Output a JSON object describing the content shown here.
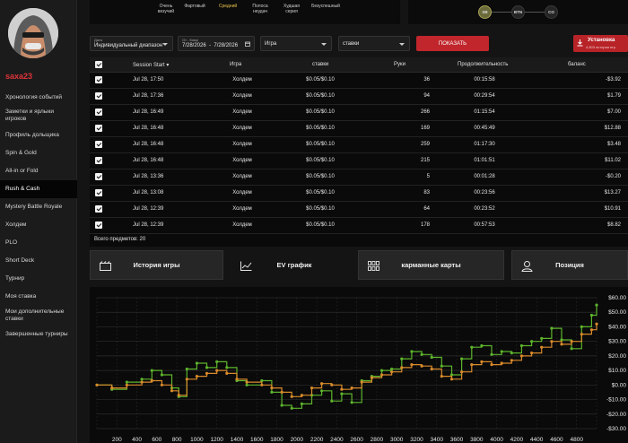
{
  "sidebar": {
    "username": "saxa23",
    "items": [
      {
        "label": "Хронология событий",
        "active": false
      },
      {
        "label": "Заметки и ярлыки игроков",
        "active": false
      },
      {
        "label": "Профиль дольщика",
        "active": false
      },
      {
        "label": "Spin & Gold",
        "active": false
      },
      {
        "label": "All-in or Fold",
        "active": false
      },
      {
        "label": "Rush & Cash",
        "active": true
      },
      {
        "label": "Mystery Battle Royale",
        "active": false
      },
      {
        "label": "Холдем",
        "active": false
      },
      {
        "label": "PLO",
        "active": false
      },
      {
        "label": "Short Deck",
        "active": false
      },
      {
        "label": "Турнир",
        "active": false
      },
      {
        "label": "Моя ставка",
        "active": false
      },
      {
        "label": "Мои дополнительные ставки",
        "active": false
      },
      {
        "label": "Завершенные турниры",
        "active": false
      }
    ]
  },
  "filters": {
    "result_options": [
      {
        "label": "Очень везучий",
        "selected": false
      },
      {
        "label": "Фартовый",
        "selected": false
      },
      {
        "label": "Средний",
        "selected": true
      },
      {
        "label": "Полоса неудач",
        "selected": false
      },
      {
        "label": "Худшая серия",
        "selected": false
      },
      {
        "label": "Безуспешный",
        "selected": false
      }
    ],
    "positions": [
      {
        "label": "SB",
        "selected": true
      },
      {
        "label": "BTN",
        "selected": false
      },
      {
        "label": "CO",
        "selected": false
      }
    ]
  },
  "controls": {
    "date_type_label": "Дата",
    "date_type_value": "Индивидуальный диапазон",
    "range_label": "От - Кому",
    "range_value": "7/28/2026  -  7/28/2026",
    "game_placeholder": "Игра",
    "stakes_placeholder": "ставки",
    "show_button": "ПОКАЗАТЬ",
    "install_title": "Установка",
    "install_sub": "4,803 истории игр"
  },
  "table": {
    "headers": {
      "session_start": "Session Start",
      "game": "Игра",
      "stakes": "ставки",
      "hands": "Руки",
      "duration": "Продолжительность",
      "balance": "баланс"
    },
    "rows": [
      {
        "start": "Jul 28, 17:50",
        "game": "Холдем",
        "stakes": "$0.05/$0.10",
        "hands": "36",
        "duration": "00:15:58",
        "balance": "-$3.92"
      },
      {
        "start": "Jul 28, 17:36",
        "game": "Холдем",
        "stakes": "$0.05/$0.10",
        "hands": "94",
        "duration": "00:29:54",
        "balance": "$1.79"
      },
      {
        "start": "Jul 28, 16:49",
        "game": "Холдем",
        "stakes": "$0.05/$0.10",
        "hands": "266",
        "duration": "01:15:54",
        "balance": "$7.00"
      },
      {
        "start": "Jul 28, 16:48",
        "game": "Холдем",
        "stakes": "$0.05/$0.10",
        "hands": "169",
        "duration": "00:45:49",
        "balance": "$12.88"
      },
      {
        "start": "Jul 28, 16:48",
        "game": "Холдем",
        "stakes": "$0.05/$0.10",
        "hands": "259",
        "duration": "01:17:30",
        "balance": "$3.48"
      },
      {
        "start": "Jul 28, 16:48",
        "game": "Холдем",
        "stakes": "$0.05/$0.10",
        "hands": "215",
        "duration": "01:01:51",
        "balance": "$11.02"
      },
      {
        "start": "Jul 28, 13:36",
        "game": "Холдем",
        "stakes": "$0.05/$0.10",
        "hands": "5",
        "duration": "00:01:28",
        "balance": "-$0.20"
      },
      {
        "start": "Jul 28, 13:08",
        "game": "Холдем",
        "stakes": "$0.05/$0.10",
        "hands": "83",
        "duration": "00:23:56",
        "balance": "$13.27"
      },
      {
        "start": "Jul 28, 12:39",
        "game": "Холдем",
        "stakes": "$0.05/$0.10",
        "hands": "64",
        "duration": "00:23:52",
        "balance": "$10.91"
      },
      {
        "start": "Jul 28, 12:39",
        "game": "Холдем",
        "stakes": "$0.05/$0.10",
        "hands": "178",
        "duration": "00:57:53",
        "balance": "$8.82"
      }
    ],
    "total": "Всего предметов: 20"
  },
  "tabs": [
    {
      "label": "История игры",
      "active": false
    },
    {
      "label": "EV график",
      "active": true
    },
    {
      "label": "карманные карты",
      "active": false
    },
    {
      "label": "Позиция",
      "active": false
    }
  ],
  "chart_data": {
    "type": "line",
    "xlim": [
      0,
      5000
    ],
    "ylim": [
      -30,
      60
    ],
    "x_ticks": [
      200,
      400,
      600,
      800,
      1000,
      1200,
      1400,
      1600,
      1800,
      2000,
      2200,
      2400,
      2600,
      2800,
      3000,
      3200,
      3400,
      3600,
      3800,
      4000,
      4200,
      4400,
      4600,
      4800
    ],
    "y_ticks": [
      "$60.00",
      "$50.00",
      "$40.00",
      "$30.00",
      "$20.00",
      "$10.00",
      "$0.00",
      "-$10.00",
      "-$20.00",
      "-$30.00"
    ],
    "grid": true,
    "series": [
      {
        "color": "#5db42c",
        "x": [
          0,
          150,
          300,
          450,
          550,
          650,
          750,
          820,
          900,
          1000,
          1100,
          1200,
          1300,
          1400,
          1500,
          1650,
          1750,
          1850,
          1950,
          2050,
          2150,
          2250,
          2350,
          2450,
          2550,
          2650,
          2750,
          2850,
          2950,
          3050,
          3150,
          3250,
          3350,
          3450,
          3550,
          3650,
          3750,
          3850,
          3950,
          4050,
          4150,
          4250,
          4350,
          4450,
          4550,
          4650,
          4750,
          4850,
          4950,
          5000
        ],
        "y": [
          0,
          -3,
          2,
          4,
          10,
          7,
          -2,
          -8,
          11,
          15,
          12,
          16,
          12,
          3,
          0,
          3,
          -5,
          -14,
          -16,
          -13,
          -7,
          -4,
          -11,
          -6,
          -12,
          3,
          6,
          10,
          11,
          18,
          23,
          21,
          19,
          13,
          7,
          18,
          26,
          27,
          21,
          23,
          22,
          27,
          30,
          32,
          39,
          31,
          25,
          40,
          48,
          55
        ]
      },
      {
        "color": "#d98a2b",
        "x": [
          0,
          150,
          300,
          450,
          550,
          650,
          750,
          820,
          900,
          1000,
          1100,
          1200,
          1300,
          1400,
          1500,
          1650,
          1750,
          1850,
          1950,
          2050,
          2150,
          2250,
          2350,
          2450,
          2550,
          2650,
          2750,
          2850,
          2950,
          3050,
          3150,
          3250,
          3350,
          3450,
          3550,
          3650,
          3750,
          3850,
          3950,
          4050,
          4150,
          4250,
          4350,
          4450,
          4550,
          4650,
          4750,
          4850,
          4950,
          5000
        ],
        "y": [
          0,
          -2,
          0,
          2,
          3,
          0,
          -4,
          -7,
          4,
          6,
          8,
          10,
          8,
          4,
          2,
          0,
          -2,
          -5,
          -8,
          -7,
          -2,
          1,
          0,
          -3,
          -2,
          2,
          5,
          7,
          9,
          12,
          14,
          13,
          11,
          6,
          4,
          9,
          14,
          16,
          14,
          15,
          17,
          20,
          22,
          26,
          30,
          28,
          30,
          35,
          38,
          42
        ]
      }
    ]
  }
}
